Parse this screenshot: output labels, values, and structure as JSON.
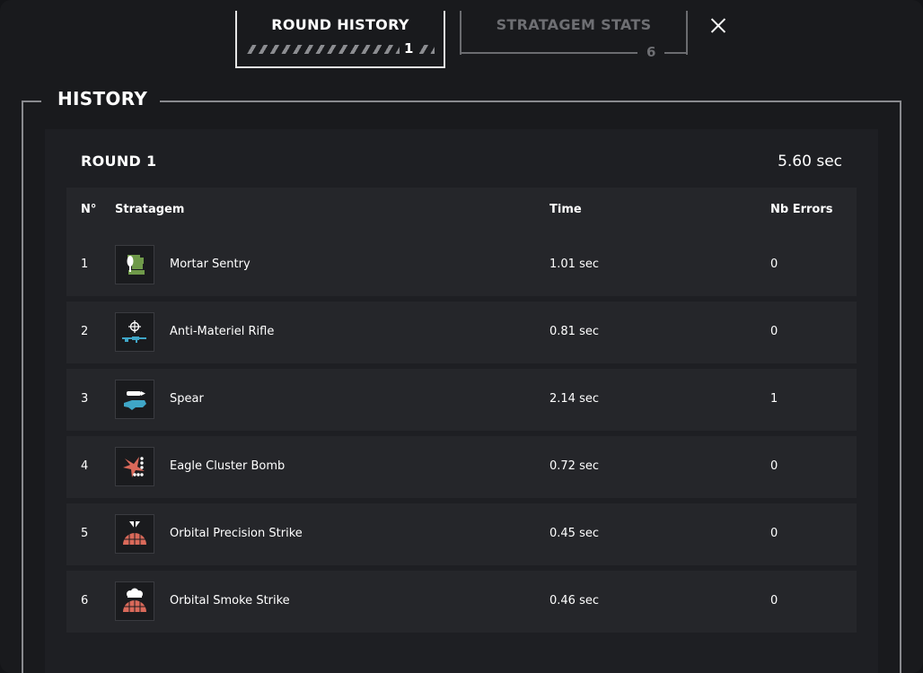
{
  "tabs": [
    {
      "label": "ROUND HISTORY",
      "count": "1",
      "active": true
    },
    {
      "label": "STRATAGEM STATS",
      "count": "6",
      "active": false
    }
  ],
  "section_title": "HISTORY",
  "round": {
    "title": "ROUND 1",
    "total_time": "5.60 sec"
  },
  "table": {
    "headers": [
      "N°",
      "Stratagem",
      "Time",
      "Nb Errors"
    ],
    "rows": [
      {
        "num": "1",
        "name": "Mortar Sentry",
        "time": "1.01 sec",
        "errors": "0",
        "icon": "mortar-sentry-icon"
      },
      {
        "num": "2",
        "name": "Anti-Materiel Rifle",
        "time": "0.81 sec",
        "errors": "0",
        "icon": "anti-materiel-rifle-icon"
      },
      {
        "num": "3",
        "name": "Spear",
        "time": "2.14 sec",
        "errors": "1",
        "icon": "spear-icon"
      },
      {
        "num": "4",
        "name": "Eagle Cluster Bomb",
        "time": "0.72 sec",
        "errors": "0",
        "icon": "eagle-cluster-bomb-icon"
      },
      {
        "num": "5",
        "name": "Orbital Precision Strike",
        "time": "0.45 sec",
        "errors": "0",
        "icon": "orbital-precision-strike-icon"
      },
      {
        "num": "6",
        "name": "Orbital Smoke Strike",
        "time": "0.46 sec",
        "errors": "0",
        "icon": "orbital-smoke-strike-icon"
      }
    ]
  },
  "colors": {
    "green_icon": "#6f9a4a",
    "blue_icon": "#3fa6c7",
    "red_icon": "#d9695a"
  }
}
